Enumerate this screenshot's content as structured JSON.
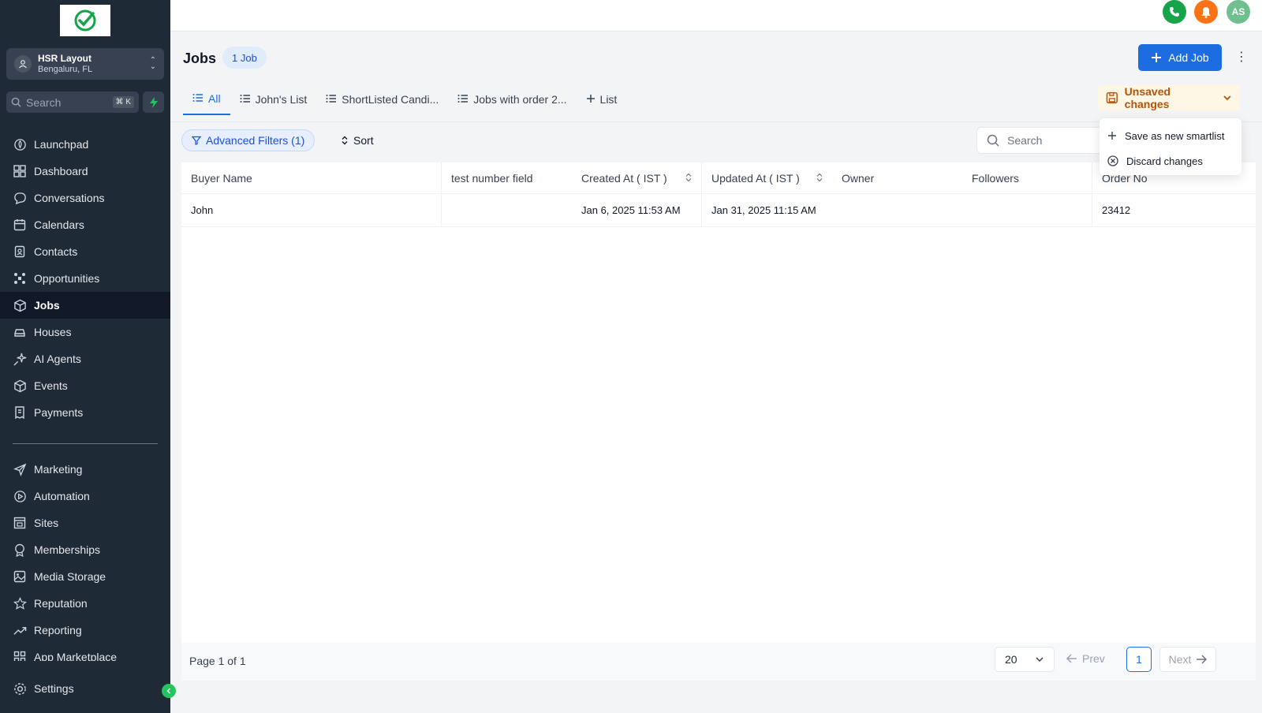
{
  "sidebar": {
    "location": {
      "name": "HSR Layout",
      "sub": "Bengaluru, FL"
    },
    "search": {
      "placeholder": "Search",
      "shortcut": "⌘ K"
    },
    "nav": [
      {
        "label": "Launchpad",
        "icon": "rocket-icon"
      },
      {
        "label": "Dashboard",
        "icon": "dashboard-icon"
      },
      {
        "label": "Conversations",
        "icon": "chat-icon"
      },
      {
        "label": "Calendars",
        "icon": "calendar-icon"
      },
      {
        "label": "Contacts",
        "icon": "contacts-icon"
      },
      {
        "label": "Opportunities",
        "icon": "opportunities-icon"
      },
      {
        "label": "Jobs",
        "icon": "box-icon",
        "active": true
      },
      {
        "label": "Houses",
        "icon": "car-icon"
      },
      {
        "label": "AI Agents",
        "icon": "sparkle-icon"
      },
      {
        "label": "Events",
        "icon": "box-icon"
      },
      {
        "label": "Payments",
        "icon": "receipt-icon"
      }
    ],
    "nav2": [
      {
        "label": "Marketing",
        "icon": "send-icon"
      },
      {
        "label": "Automation",
        "icon": "automation-icon"
      },
      {
        "label": "Sites",
        "icon": "sites-icon"
      },
      {
        "label": "Memberships",
        "icon": "badge-icon"
      },
      {
        "label": "Media Storage",
        "icon": "image-icon"
      },
      {
        "label": "Reputation",
        "icon": "star-icon"
      },
      {
        "label": "Reporting",
        "icon": "trend-icon"
      },
      {
        "label": "App Marketplace",
        "icon": "grid-icon"
      }
    ],
    "settings": {
      "label": "Settings",
      "icon": "gear-icon"
    }
  },
  "topbar": {
    "avatar_initials": "AS"
  },
  "header": {
    "title": "Jobs",
    "count_badge": "1 Job",
    "add_button": "Add Job"
  },
  "tabs": [
    {
      "label": "All",
      "active": true
    },
    {
      "label": "John's List"
    },
    {
      "label": "ShortListed Candi..."
    },
    {
      "label": "Jobs with order 2..."
    },
    {
      "label": "List",
      "add": true
    }
  ],
  "unsaved": {
    "label": "Unsaved changes"
  },
  "dropdown": {
    "items": [
      {
        "label": "Save as new smartlist",
        "icon": "plus-icon"
      },
      {
        "label": "Discard changes",
        "icon": "x-circle-icon"
      }
    ]
  },
  "filters": {
    "advanced_label": "Advanced Filters (1)",
    "sort_label": "Sort",
    "search_placeholder": "Search"
  },
  "table": {
    "columns": [
      "Buyer Name",
      "test number field",
      "Created At ( IST )",
      "Updated At ( IST )",
      "Owner",
      "Followers",
      "Order No"
    ],
    "rows": [
      {
        "buyer": "John",
        "test_number": "",
        "created": "Jan 6, 2025 11:53 AM",
        "updated": "Jan 31, 2025 11:15 AM",
        "owner": "",
        "followers": "",
        "order_no": "23412"
      }
    ]
  },
  "pagination": {
    "page_info": "Page 1 of 1",
    "per_page": "20",
    "prev": "Prev",
    "current": "1",
    "next": "Next"
  },
  "colors": {
    "accent": "#1d6ce0",
    "sidebar_bg": "#1f2a37",
    "unsaved_text": "#b45309",
    "phone_green": "#16a34a",
    "bell_orange": "#f97316",
    "avatar_green": "#6fbf8f"
  }
}
